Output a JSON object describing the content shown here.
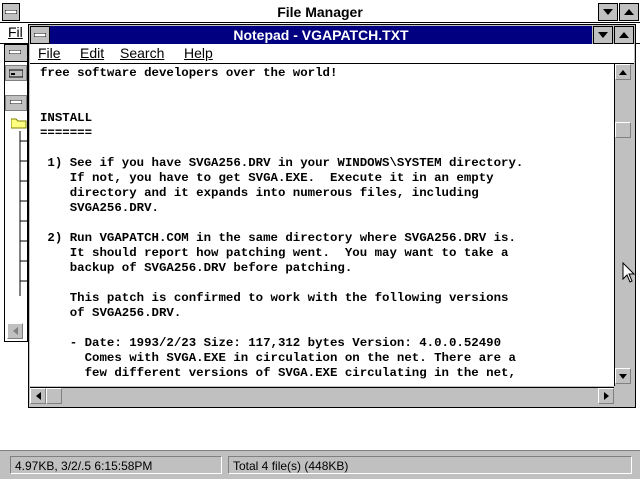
{
  "file_manager": {
    "title": "File Manager",
    "menu_file_label": "Fil",
    "status_left": "4.97KB, 3/2/.5 6:15:58PM",
    "status_right": "Total 4 file(s) (448KB)"
  },
  "notepad": {
    "title": "Notepad - VGAPATCH.TXT",
    "menu": [
      {
        "label": "File"
      },
      {
        "label": "Edit"
      },
      {
        "label": "Search"
      },
      {
        "label": "Help"
      }
    ],
    "text_lines": [
      "free software developers over the world!",
      "",
      "",
      "INSTALL",
      "=======",
      "",
      " 1) See if you have SVGA256.DRV in your WINDOWS\\SYSTEM directory.",
      "    If not, you have to get SVGA.EXE.  Execute it in an empty",
      "    directory and it expands into numerous files, including",
      "    SVGA256.DRV.",
      "",
      " 2) Run VGAPATCH.COM in the same directory where SVGA256.DRV is.",
      "    It should report how patching went.  You may want to take a",
      "    backup of SVGA256.DRV before patching.",
      "",
      "    This patch is confirmed to work with the following versions",
      "    of SVGA256.DRV.",
      "",
      "    - Date: 1993/2/23 Size: 117,312 bytes Version: 4.0.0.52490",
      "      Comes with SVGA.EXE in circulation on the net. There are a",
      "      few different versions of SVGA.EXE circulating in the net,"
    ]
  }
}
